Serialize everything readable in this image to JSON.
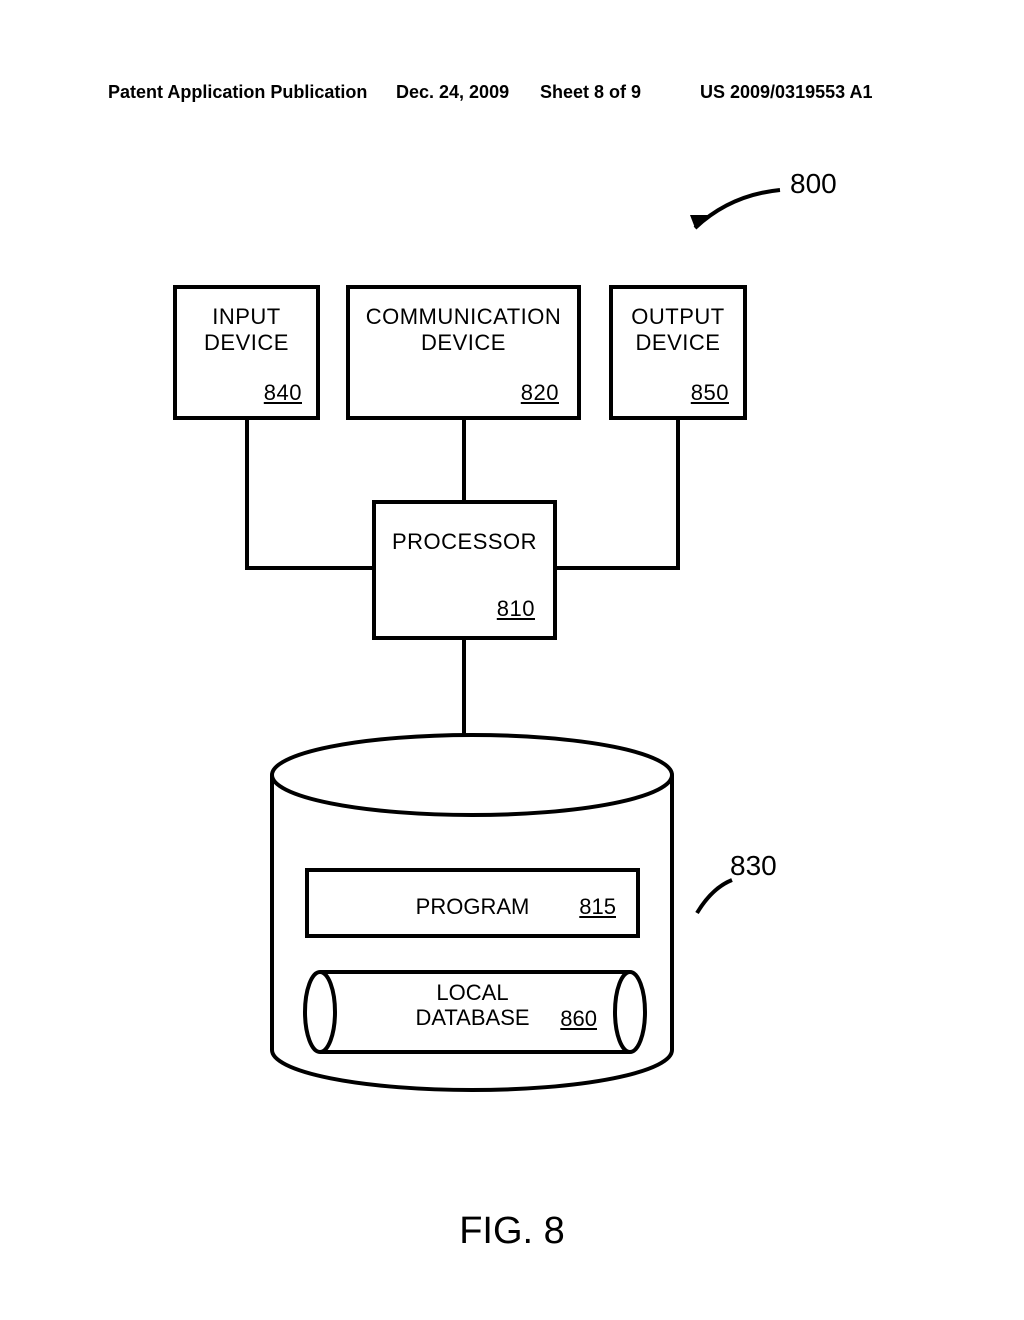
{
  "header": {
    "left": "Patent Application Publication",
    "date": "Dec. 24, 2009",
    "sheet": "Sheet 8 of 9",
    "pubno": "US 2009/0319553 A1"
  },
  "reference": {
    "main": "800"
  },
  "blocks": {
    "input": {
      "line1": "INPUT",
      "line2": "DEVICE",
      "num": "840"
    },
    "comm": {
      "line1": "COMMUNICATION",
      "line2": "DEVICE",
      "num": "820"
    },
    "output": {
      "line1": "OUTPUT",
      "line2": "DEVICE",
      "num": "850"
    },
    "processor": {
      "label": "PROCESSOR",
      "num": "810"
    },
    "storage": {
      "num": "830"
    },
    "program": {
      "label": "PROGRAM",
      "num": "815"
    },
    "localdb": {
      "line1": "LOCAL",
      "line2": "DATABASE",
      "num": "860"
    }
  },
  "figure": {
    "caption": "FIG. 8"
  }
}
